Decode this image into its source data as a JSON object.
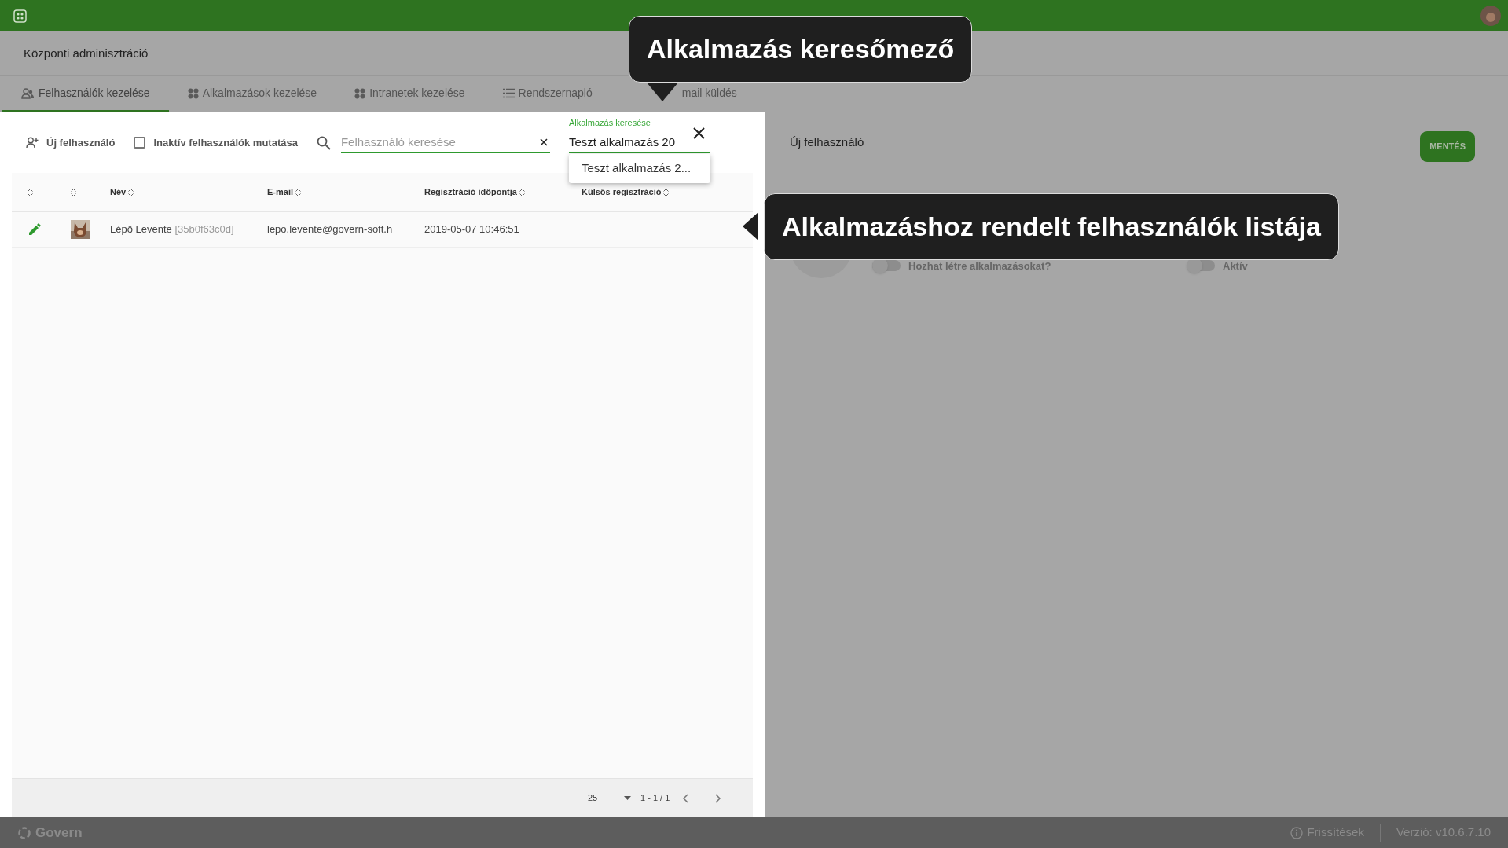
{
  "page_title": "Központi adminisztráció",
  "tabs": [
    {
      "label": "Felhasználók kezelése",
      "kind": "users",
      "selected": true
    },
    {
      "label": "Alkalmazások kezelése",
      "kind": "apps",
      "selected": false
    },
    {
      "label": "Intranetek kezelése",
      "kind": "apps",
      "selected": false
    },
    {
      "label": "Rendszernapló",
      "kind": "list",
      "selected": false
    },
    {
      "label": "mail küldés",
      "kind": "plain",
      "selected": false
    }
  ],
  "toolbar": {
    "new_user": "Új felhasználó",
    "inactive_filter": {
      "label": "Inaktív felhasználók mutatása",
      "checked": false
    },
    "user_search": {
      "placeholder": "Felhasználó keresése"
    },
    "app_search": {
      "label": "Alkalmazás keresése",
      "value": "Teszt alkalmazás 20",
      "suggestions": [
        "Teszt alkalmazás 2..."
      ]
    }
  },
  "table": {
    "columns": [
      "Név",
      "E-mail",
      "Regisztráció időpontja",
      "Külsős regisztráció"
    ],
    "rows": [
      {
        "name": "Lépő Levente",
        "id": "[35b0f63c0d]",
        "email": "lepo.levente@govern-soft.h",
        "registered": "2019-05-07 10:46:51"
      }
    ]
  },
  "pagination": {
    "page_size": "25",
    "range": "1 - 1 / 1"
  },
  "detail": {
    "title": "Új felhasználó",
    "save": "MENTÉS",
    "toggles": [
      {
        "label": "Hozhat létre alkalmazásokat?",
        "on": false
      },
      {
        "label": "Aktív",
        "on": false
      }
    ]
  },
  "footer": {
    "brand": "Govern",
    "updates": "Frissítések",
    "version": "Verzió: v10.6.7.10"
  },
  "callouts": [
    {
      "text": "Alkalmazás keresőmező",
      "kind": "down"
    },
    {
      "text": "Alkalmazáshoz rendelt felhasználók listája",
      "kind": "left"
    }
  ]
}
